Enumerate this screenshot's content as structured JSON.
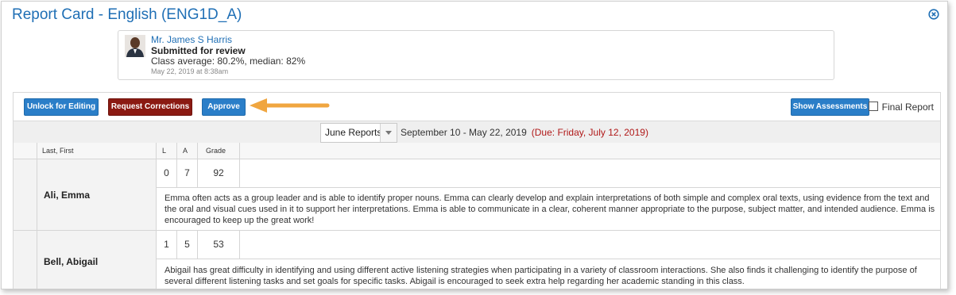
{
  "window": {
    "title": "Report Card - English (ENG1D_A)",
    "close_icon": "close-circle-icon",
    "accent": "#1f6fb5"
  },
  "submission": {
    "teacher": "Mr. James S Harris",
    "status": "Submitted for review",
    "average": "Class average: 80.2%, median: 82%",
    "date": "May 22, 2019 at 8:38am"
  },
  "toolbar": {
    "unlock": "Unlock for Editing",
    "request": "Request Corrections",
    "approve": "Approve",
    "show_assessments": "Show Assessments",
    "final_report": "Final Report",
    "final_checked": false
  },
  "filter": {
    "report_selected": "June Reports",
    "range": "September 10 - May 22, 2019",
    "due": "(Due: Friday, July 12, 2019)"
  },
  "table": {
    "headers": {
      "name": "Last, First",
      "l": "L",
      "a": "A",
      "grade": "Grade"
    },
    "rows": [
      {
        "name": "Ali, Emma",
        "l": "0",
        "a": "7",
        "grade": "92",
        "comment": "Emma often acts as a group leader and is able to identify proper nouns. Emma can clearly develop and explain interpretations of both simple and complex oral texts, using evidence from the text and the oral and visual cues used in it to support her interpretations. Emma is able to communicate in a clear, coherent manner appropriate to the purpose, subject matter, and intended audience. Emma is encouraged to keep up the great work!"
      },
      {
        "name": "Bell, Abigail",
        "l": "1",
        "a": "5",
        "grade": "53",
        "comment": "Abigail has great difficulty in identifying and using different active listening strategies when participating in a variety of classroom interactions. She also finds it challenging to identify the purpose of several different listening tasks and set goals for specific tasks. Abigail is encouraged to seek extra help regarding her academic standing in this class."
      }
    ]
  }
}
